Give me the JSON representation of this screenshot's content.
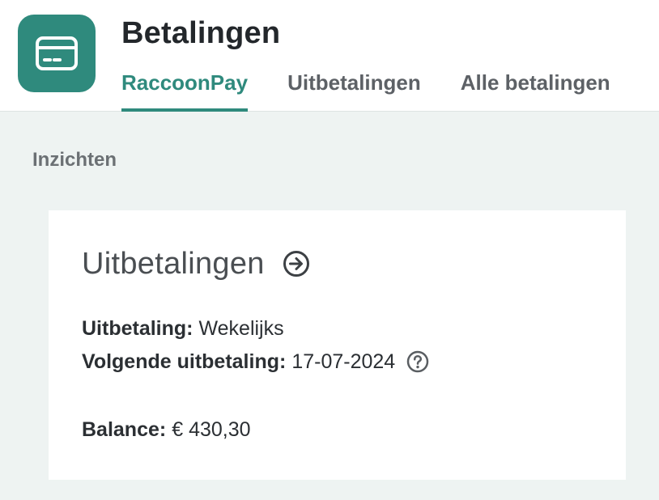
{
  "header": {
    "title": "Betalingen",
    "app_icon": "credit-card-icon",
    "accent_color": "#2f8a7d",
    "tabs": [
      {
        "label": "RaccoonPay",
        "active": true
      },
      {
        "label": "Uitbetalingen",
        "active": false
      },
      {
        "label": "Alle betalingen",
        "active": false
      }
    ]
  },
  "section": {
    "title": "Inzichten"
  },
  "card": {
    "title": "Uitbetalingen",
    "title_icon": "arrow-right-circle-icon",
    "payout_label": "Uitbetaling:",
    "payout_value": "Wekelijks",
    "next_payout_label": "Volgende uitbetaling:",
    "next_payout_value": "17-07-2024",
    "help_icon": "question-circle-icon",
    "balance_label": "Balance:",
    "balance_value": "€ 430,30"
  }
}
